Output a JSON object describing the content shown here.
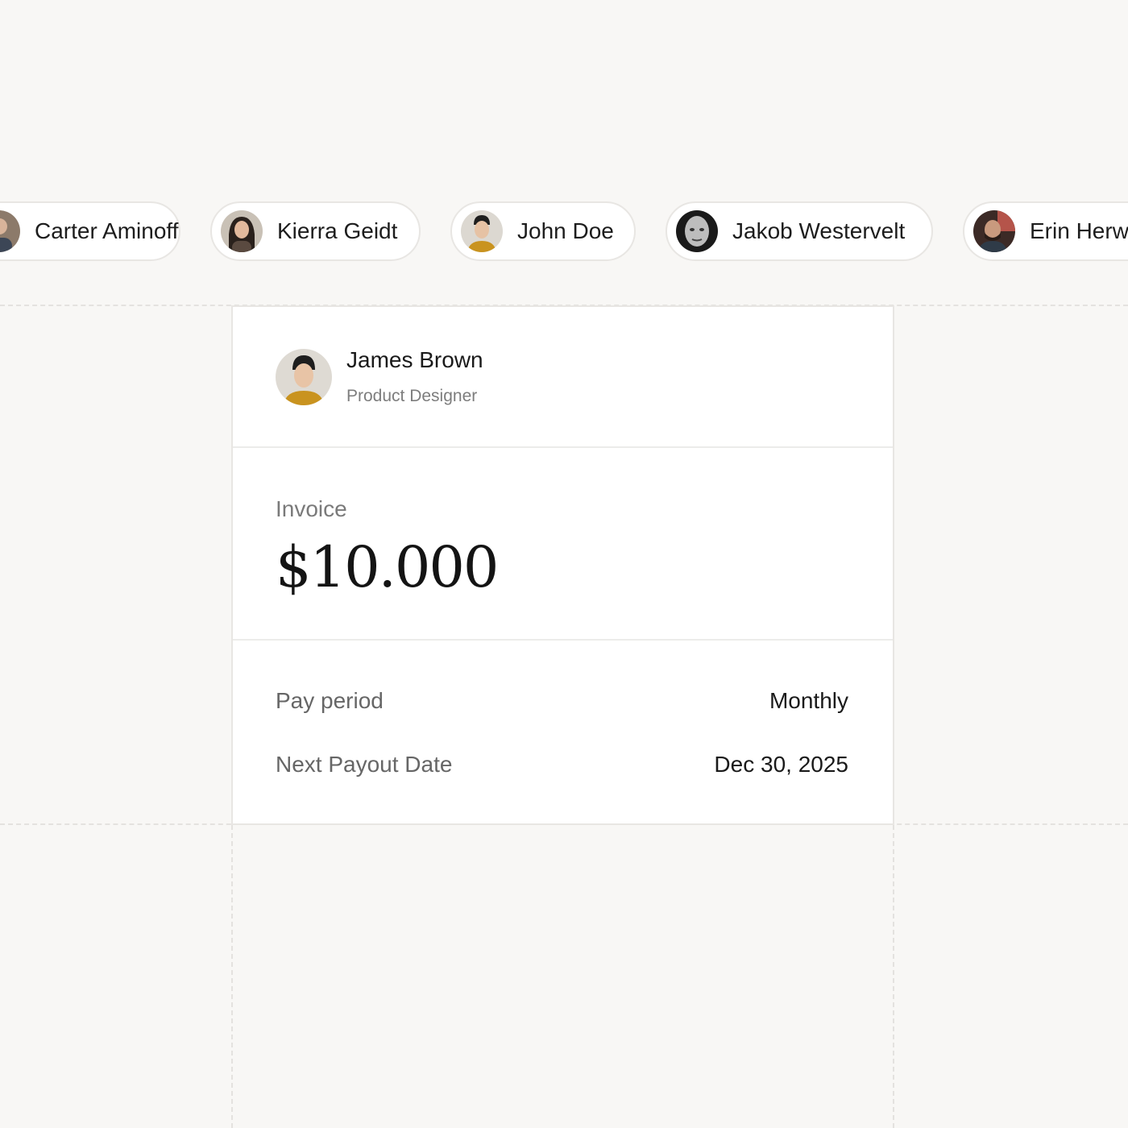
{
  "people_strip": {
    "people": [
      {
        "name": "Carter Aminoff",
        "avatar": "carter-avatar"
      },
      {
        "name": "Kierra Geidt",
        "avatar": "kierra-avatar"
      },
      {
        "name": "John Doe",
        "avatar": "john-avatar"
      },
      {
        "name": "Jakob Westervelt",
        "avatar": "jakob-avatar"
      },
      {
        "name": "Erin Herw",
        "avatar": "erin-avatar"
      }
    ]
  },
  "card": {
    "profile": {
      "name": "James Brown",
      "role": "Product Designer"
    },
    "invoice": {
      "label": "Invoice",
      "amount": "$10.000"
    },
    "details": [
      {
        "label": "Pay period",
        "value": "Monthly"
      },
      {
        "label": "Next Payout Date",
        "value": "Dec 30, 2025"
      }
    ]
  },
  "colors": {
    "background": "#f8f7f5",
    "card": "#ffffff",
    "border": "#e8e6e3",
    "text_primary": "#1a1a1a",
    "text_secondary": "#7a7a7a"
  }
}
